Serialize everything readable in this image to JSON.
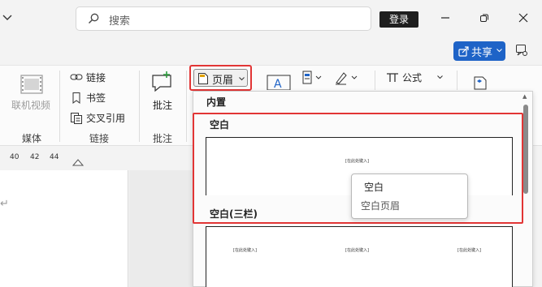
{
  "titlebar": {
    "search_placeholder": "搜索",
    "login_label": "登录"
  },
  "share": {
    "label": "共享"
  },
  "ribbon": {
    "media": {
      "online_video_label": "联机视频",
      "group_label": "媒体"
    },
    "links": {
      "items": [
        "链接",
        "书签",
        "交叉引用"
      ],
      "group_label": "链接"
    },
    "comments": {
      "comment_label": "批注",
      "group_label": "批注"
    },
    "header_button_label": "页眉",
    "formula_label": "公式"
  },
  "ruler": {
    "ticks": [
      "40",
      "42",
      "44"
    ]
  },
  "gallery": {
    "section_label": "内置",
    "options": [
      {
        "title": "空白",
        "placeholder": "[在此处键入]"
      },
      {
        "title": "空白(三栏)",
        "placeholders": [
          "[在此处键入]",
          "[在此处键入]",
          "[在此处键入]"
        ]
      }
    ]
  },
  "tooltip": {
    "title": "空白",
    "description": "空白页眉"
  },
  "colors": {
    "accent": "#1e63c7",
    "highlight_border": "#e23535",
    "login_bg": "#1f1f1f"
  }
}
